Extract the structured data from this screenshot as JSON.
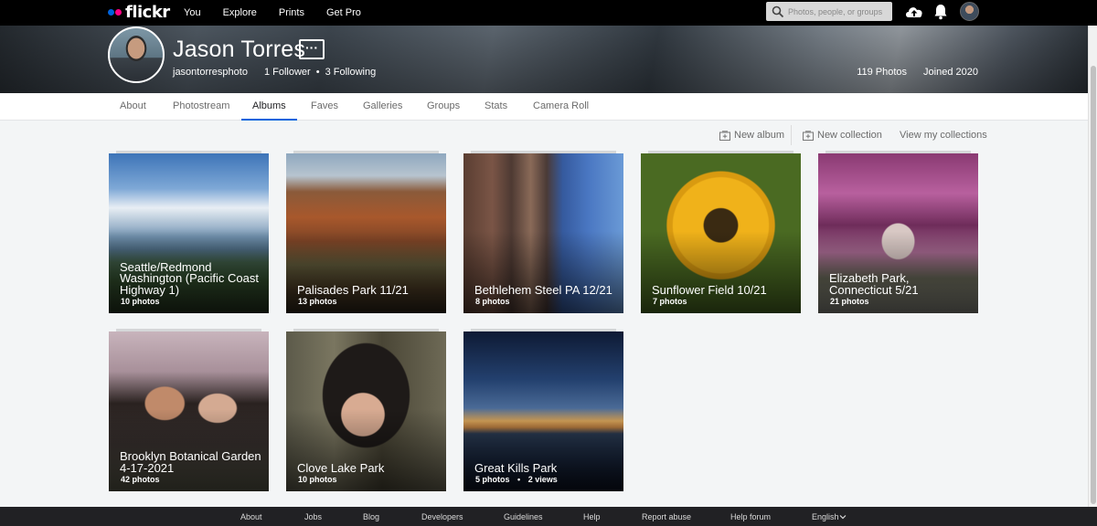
{
  "brand": {
    "logo_text": "flickr",
    "blue": "#0063dc",
    "pink": "#ff0084"
  },
  "topnav": {
    "links": [
      "You",
      "Explore",
      "Prints",
      "Get Pro"
    ],
    "search_placeholder": "Photos, people, or groups",
    "icons": [
      "search-icon",
      "upload-cloud-icon",
      "bell-icon",
      "avatar"
    ]
  },
  "profile": {
    "name": "Jason Torres",
    "more_label": "···",
    "handle": "jasontorresphoto",
    "followers": "1 Follower",
    "bullet": "•",
    "following": "3 Following",
    "photos": "119 Photos",
    "joined": "Joined 2020"
  },
  "tabs": [
    {
      "label": "About"
    },
    {
      "label": "Photostream"
    },
    {
      "label": "Albums",
      "active": true
    },
    {
      "label": "Faves"
    },
    {
      "label": "Galleries"
    },
    {
      "label": "Groups"
    },
    {
      "label": "Stats"
    },
    {
      "label": "Camera Roll"
    }
  ],
  "toolbar": {
    "new_album": "New album",
    "new_collection": "New collection",
    "view_collections": "View my collections"
  },
  "albums": [
    {
      "title": "Seattle/Redmond Washington (Pacific Coast Highway 1)",
      "count": "10 photos"
    },
    {
      "title": "Palisades Park 11/21",
      "count": "13 photos"
    },
    {
      "title": "Bethlehem Steel PA 12/21",
      "count": "8 photos"
    },
    {
      "title": "Sunflower Field 10/21",
      "count": "7 photos"
    },
    {
      "title": "Elizabeth Park, Connecticut 5/21",
      "count": "21 photos"
    },
    {
      "title": "Brooklyn Botanical Garden 4-17-2021",
      "count": "42 photos"
    },
    {
      "title": "Clove Lake Park",
      "count": "10 photos"
    },
    {
      "title": "Great Kills Park",
      "count": "5 photos",
      "views": "2 views",
      "views_sep": "•"
    }
  ],
  "footer": {
    "links": [
      "About",
      "Jobs",
      "Blog",
      "Developers",
      "Guidelines",
      "Help",
      "Report abuse",
      "Help forum"
    ],
    "language": "English"
  }
}
